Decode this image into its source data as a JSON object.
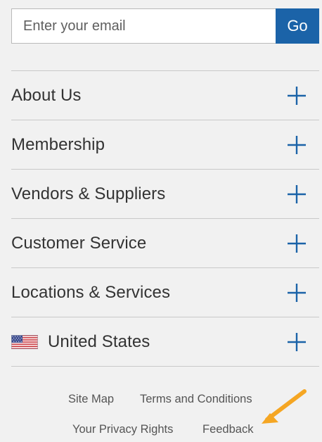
{
  "newsletter": {
    "email_placeholder": "Enter your email",
    "go_label": "Go"
  },
  "menu": {
    "items": [
      {
        "label": "About Us",
        "icon": "plus-icon"
      },
      {
        "label": "Membership",
        "icon": "plus-icon"
      },
      {
        "label": "Vendors & Suppliers",
        "icon": "plus-icon"
      },
      {
        "label": "Customer Service",
        "icon": "plus-icon"
      },
      {
        "label": "Locations & Services",
        "icon": "plus-icon"
      },
      {
        "label": "United States",
        "icon": "plus-icon",
        "flag": "us-flag-icon"
      }
    ]
  },
  "footer": {
    "site_map": "Site Map",
    "terms": "Terms and Conditions",
    "privacy": "Your Privacy Rights",
    "feedback": "Feedback"
  },
  "colors": {
    "background": "#f1f1f1",
    "accent": "#1b63a8",
    "annotation_arrow": "#f5a623"
  }
}
